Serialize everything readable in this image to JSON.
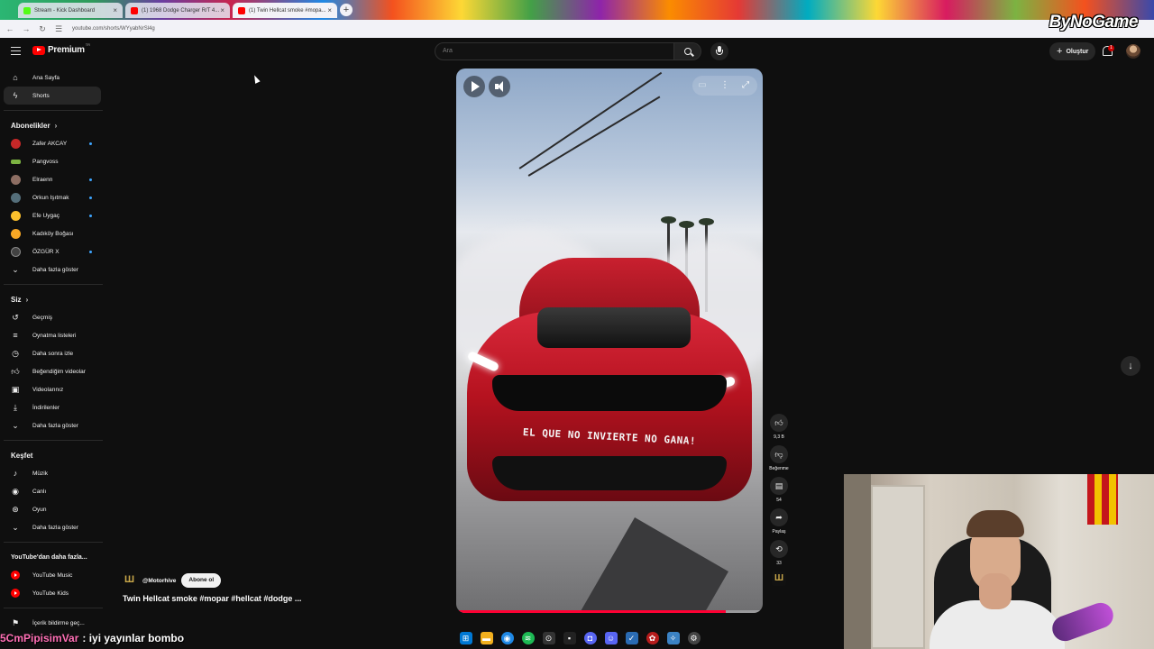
{
  "browser": {
    "tabs": [
      {
        "label": "Stream - Kick Dashboard",
        "color": "#53fc18"
      },
      {
        "label": "(1) 1968 Dodge Charger R/T 4...",
        "color": "#ff0000"
      },
      {
        "label": "(1) Twin Hellcat smoke #mopa...",
        "color": "#ff0000"
      }
    ],
    "url": "youtube.com/shorts/WYyabNrSl4g",
    "overlay_brand": "ByNoGame"
  },
  "header": {
    "logo_text": "Premium",
    "logo_sup": "TR",
    "search_placeholder": "Ara",
    "create_label": "Oluştur",
    "notif_count": "1"
  },
  "sidebar": {
    "main": [
      {
        "label": "Ana Sayfa",
        "icon": "home-icon"
      },
      {
        "label": "Shorts",
        "icon": "shorts-icon"
      }
    ],
    "subscriptions_title": "Abonelikler",
    "subscriptions": [
      {
        "label": "Zafer AKCAY",
        "color": "#c62828"
      },
      {
        "label": "Pangvoss",
        "color": "#7cb342"
      },
      {
        "label": "Elraenn",
        "color": "#8d6e63"
      },
      {
        "label": "Orkun Işıtmak",
        "color": "#546e7a"
      },
      {
        "label": "Efe Uygaç",
        "color": "#fbc02d"
      },
      {
        "label": "Kadıköy Boğası",
        "color": "#f9a825"
      },
      {
        "label": "ÖZGÜR X",
        "color": "#424242"
      }
    ],
    "subs_more": "Daha fazla göster",
    "you_title": "Siz",
    "you": [
      {
        "label": "Geçmiş",
        "icon": "history-icon"
      },
      {
        "label": "Oynatma listeleri",
        "icon": "playlist-icon"
      },
      {
        "label": "Daha sonra izle",
        "icon": "clock-icon"
      },
      {
        "label": "Beğendiğim videolar",
        "icon": "thumbs-up-icon"
      },
      {
        "label": "Videolarınız",
        "icon": "video-icon"
      },
      {
        "label": "İndirilenler",
        "icon": "download-icon"
      }
    ],
    "you_more": "Daha fazla göster",
    "explore_title": "Keşfet",
    "explore": [
      {
        "label": "Müzik",
        "icon": "music-icon"
      },
      {
        "label": "Canlı",
        "icon": "live-icon"
      },
      {
        "label": "Oyun",
        "icon": "gaming-icon"
      }
    ],
    "explore_more": "Daha fazla göster",
    "more_yt_title": "YouTube'dan daha fazla...",
    "more_yt": [
      {
        "label": "YouTube Music"
      },
      {
        "label": "YouTube Kids"
      }
    ],
    "report_label": "İçerik bildirme geç..."
  },
  "video": {
    "bumper_text": "EL QUE NO INVIERTE NO GANA!",
    "progress": 0.88,
    "channel": "@Motorhive",
    "subscribe_label": "Abone ol",
    "title": "Twin Hellcat smoke #mopar #hellcat #dodge ...",
    "likes": "9,3 B",
    "dislike_label": "Beğenme",
    "comments": "54",
    "share_label": "Paylaş",
    "remix_count": "33"
  },
  "chat": {
    "user": "5CmPipisimVar",
    "message": ": iyi yayınlar bombo"
  }
}
